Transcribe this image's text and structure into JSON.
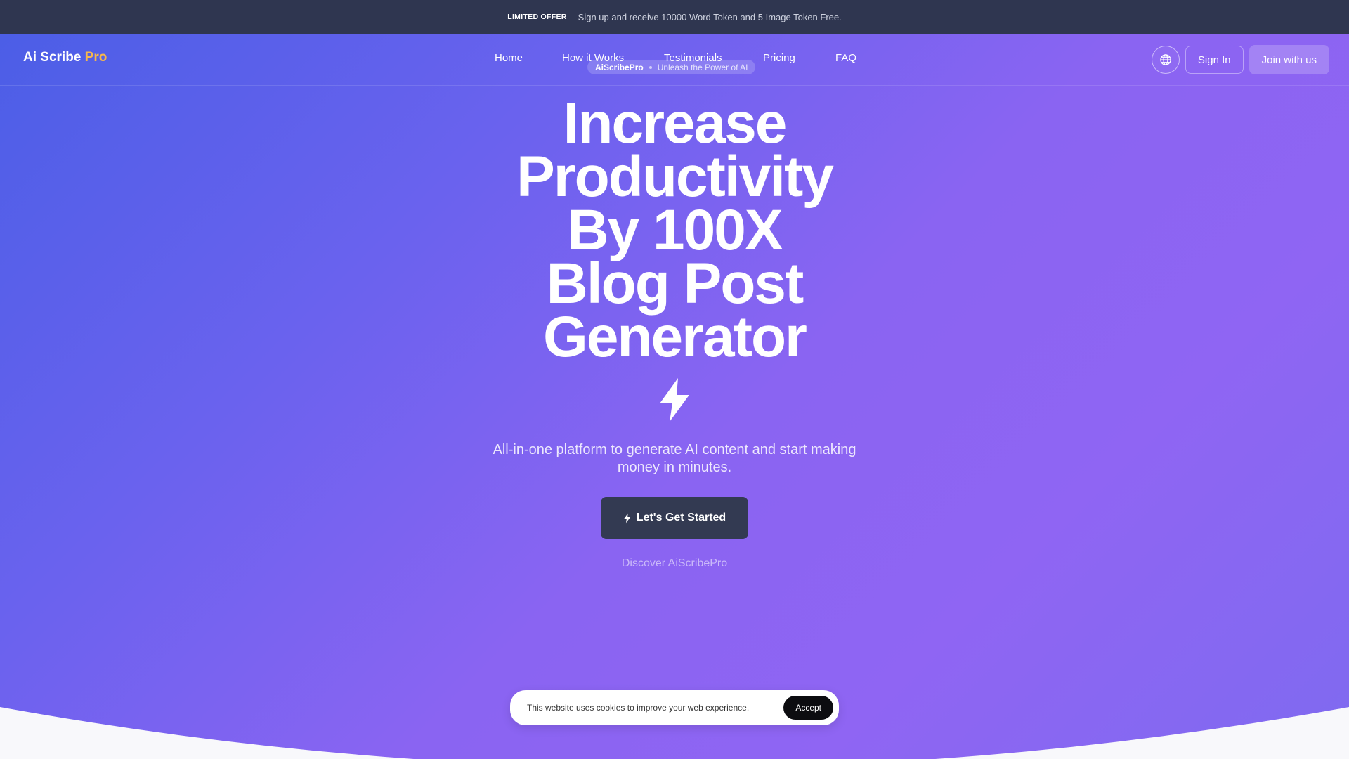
{
  "promo": {
    "tag": "LIMITED OFFER",
    "text": "Sign up and receive 10000 Word Token and 5 Image Token Free."
  },
  "header": {
    "logo_main": "Ai Scribe ",
    "logo_accent": "Pro",
    "nav": [
      "Home",
      "How it Works",
      "Testimonials",
      "Pricing",
      "FAQ"
    ],
    "sign_in": "Sign In",
    "join": "Join with us",
    "language_icon": "globe-icon"
  },
  "hero": {
    "pill_brand": "AiScribePro",
    "pill_text": "Unleash the Power of AI",
    "headline_lines": [
      "Increase",
      "Productivity",
      "By 100X",
      "Blog Post",
      "Generator"
    ],
    "headline_icon": "lightning-bolt-icon",
    "subtext": "All-in-one platform to generate AI content and start making money in minutes.",
    "cta_label": "Let's Get Started",
    "cta_icon": "lightning-bolt-icon",
    "discover": "Discover AiScribePro"
  },
  "cookie": {
    "text": "This website uses cookies to improve your web experience.",
    "accept": "Accept"
  },
  "colors": {
    "promo_bg": "#2f3650",
    "logo_accent": "#f7b84b",
    "cta_bg": "#333a52",
    "cookie_button": "#0c0c10"
  }
}
